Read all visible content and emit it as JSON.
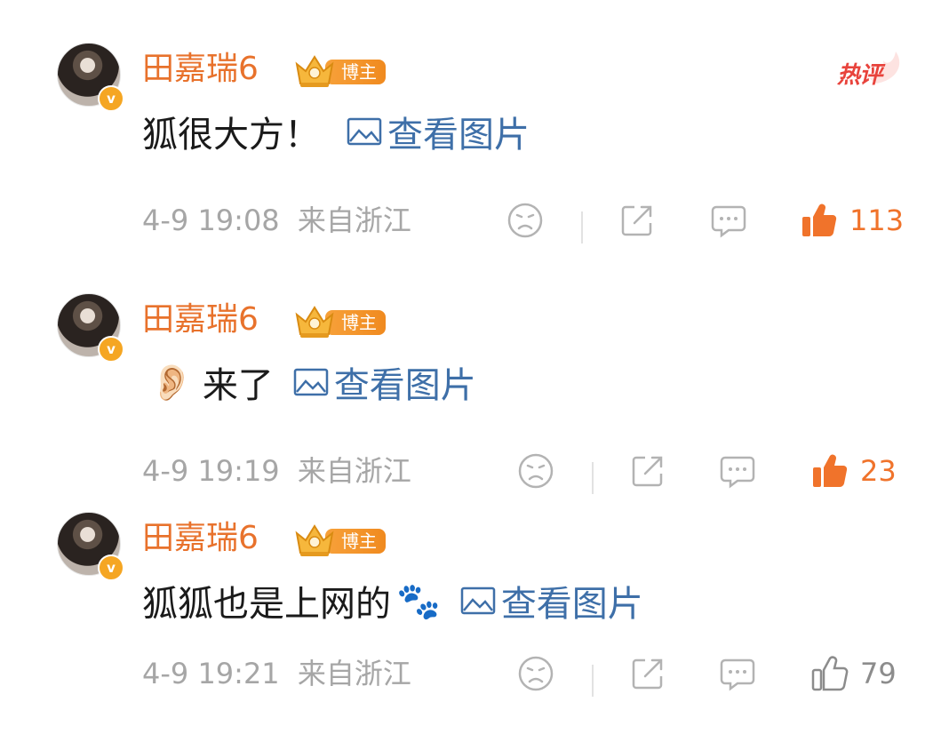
{
  "comments": [
    {
      "username": "田嘉瑞6",
      "host_badge": "博主",
      "verified_mark": "v",
      "hot_badge": "热评",
      "emoji": "",
      "text": "狐很大方！",
      "view_image_label": "查看图片",
      "time": "4-9 19:08",
      "location": "来自浙江",
      "likes": "113",
      "liked": true,
      "icons": [
        "dislike-face-icon",
        "share-icon",
        "comment-icon",
        "thumbs-up-icon"
      ]
    },
    {
      "username": "田嘉瑞6",
      "host_badge": "博主",
      "verified_mark": "v",
      "hot_badge": "",
      "emoji": "👂🏻",
      "text": "来了",
      "view_image_label": "查看图片",
      "time": "4-9 19:19",
      "location": "来自浙江",
      "likes": "23",
      "liked": true,
      "icons": [
        "dislike-face-icon",
        "share-icon",
        "comment-icon",
        "thumbs-up-icon"
      ]
    },
    {
      "username": "田嘉瑞6",
      "host_badge": "博主",
      "verified_mark": "v",
      "hot_badge": "",
      "emoji": "🐾",
      "text": "狐狐也是上网的",
      "view_image_label": "查看图片",
      "time": "4-9 19:21",
      "location": "来自浙江",
      "likes": "79",
      "liked": false,
      "icons": [
        "dislike-face-icon",
        "share-icon",
        "comment-icon",
        "thumbs-up-icon"
      ]
    }
  ],
  "colors": {
    "username": "#e8722c",
    "link": "#3e6fa8",
    "meta": "#a6a6a6",
    "liked": "#f0732b",
    "icon": "#b3b3b3",
    "hot": "#e8433c",
    "badge": "#f5a623"
  }
}
